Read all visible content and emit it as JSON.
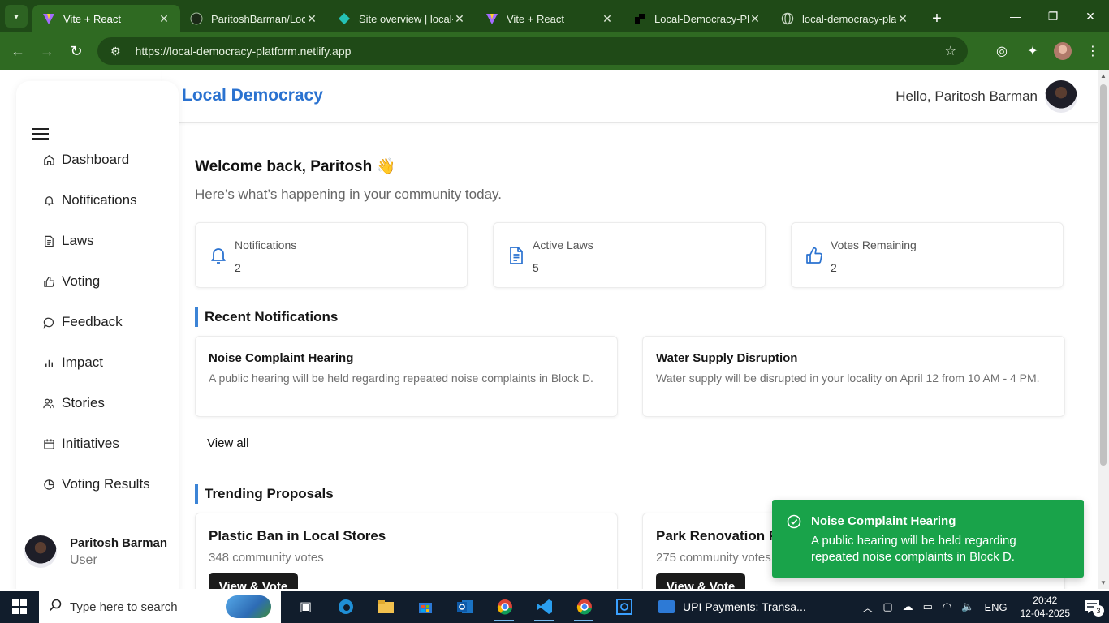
{
  "browser": {
    "tabs": [
      {
        "title": "Vite + React",
        "active": true
      },
      {
        "title": "ParitoshBarman/Loca",
        "active": false
      },
      {
        "title": "Site overview | local-c",
        "active": false
      },
      {
        "title": "Vite + React",
        "active": false
      },
      {
        "title": "Local-Democracy-Pla",
        "active": false
      },
      {
        "title": "local-democracy-plat",
        "active": false
      }
    ],
    "url": "https://local-democracy-platform.netlify.app"
  },
  "app": {
    "brand": "Local Democracy",
    "greeting": "Hello, Paritosh Barman"
  },
  "sidebar": {
    "items": [
      {
        "label": "Dashboard",
        "icon": "home-icon"
      },
      {
        "label": "Notifications",
        "icon": "bell-icon"
      },
      {
        "label": "Laws",
        "icon": "document-icon"
      },
      {
        "label": "Voting",
        "icon": "thumbs-up-icon"
      },
      {
        "label": "Feedback",
        "icon": "message-icon"
      },
      {
        "label": "Impact",
        "icon": "bar-chart-icon"
      },
      {
        "label": "Stories",
        "icon": "users-icon"
      },
      {
        "label": "Initiatives",
        "icon": "calendar-icon"
      },
      {
        "label": "Voting Results",
        "icon": "pie-chart-icon"
      }
    ],
    "profile": {
      "name": "Paritosh Barman",
      "role": "User"
    }
  },
  "main": {
    "welcome": "Welcome back, Paritosh 👋",
    "subtitle": "Here’s what’s happening in your community today.",
    "stats": [
      {
        "label": "Notifications",
        "value": "2",
        "icon": "bell-icon"
      },
      {
        "label": "Active Laws",
        "value": "5",
        "icon": "document-icon"
      },
      {
        "label": "Votes Remaining",
        "value": "2",
        "icon": "thumbs-up-icon"
      }
    ],
    "recent_title": "Recent Notifications",
    "notifications": [
      {
        "title": "Noise Complaint Hearing",
        "desc": "A public hearing will be held regarding repeated noise complaints in Block D."
      },
      {
        "title": "Water Supply Disruption",
        "desc": "Water supply will be disrupted in your locality on April 12 from 10 AM - 4 PM."
      }
    ],
    "view_all": "View all",
    "trending_title": "Trending Proposals",
    "proposals": [
      {
        "title": "Plastic Ban in Local Stores",
        "votes": "348 community votes",
        "button": "View & Vote"
      },
      {
        "title": "Park Renovation P",
        "votes": "275 community votes",
        "button": "View & Vote"
      }
    ]
  },
  "toast": {
    "title": "Noise Complaint Hearing",
    "desc": "A public hearing will be held regarding repeated noise complaints in Block D."
  },
  "taskbar": {
    "search_placeholder": "Type here to search",
    "pinned_app": "UPI Payments: Transa...",
    "language": "ENG",
    "time": "20:42",
    "date": "12-04-2025",
    "notification_count": "3"
  },
  "colors": {
    "accent": "#2a72d0",
    "toast": "#19a34a",
    "chrome": "#2f6a22"
  }
}
